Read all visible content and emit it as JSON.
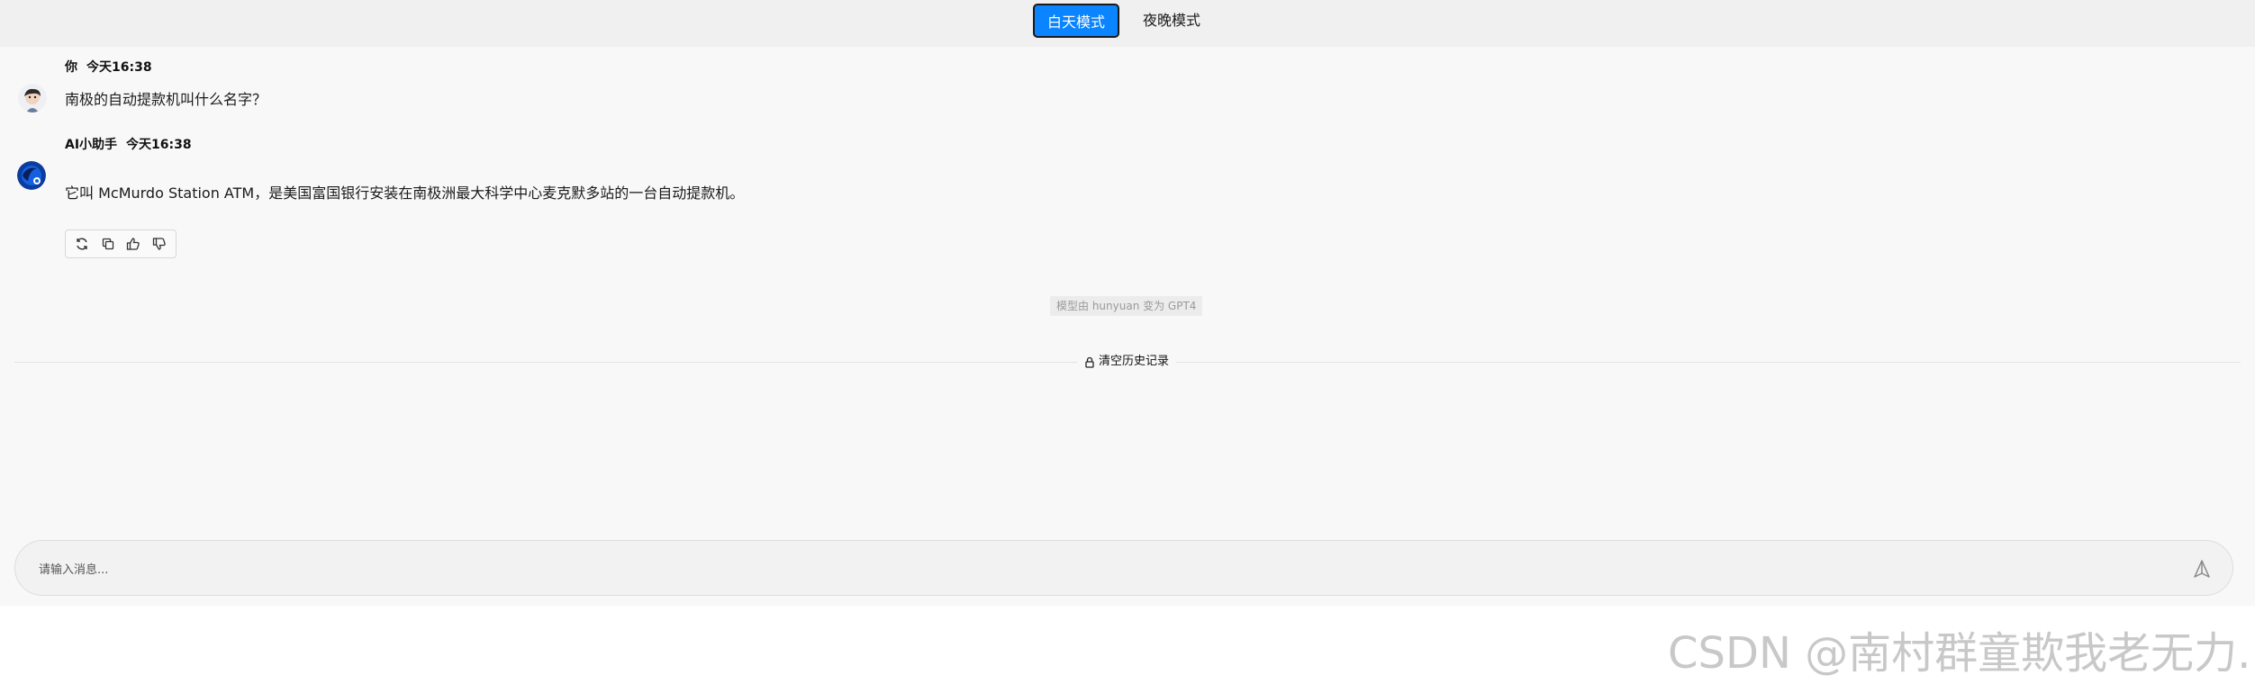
{
  "mode_switch": {
    "day_label": "白天模式",
    "night_label": "夜晚模式",
    "active": "day",
    "accent_color": "#0a84ff"
  },
  "messages": [
    {
      "role": "user",
      "author": "你",
      "time": "今天16:38",
      "text": "南极的自动提款机叫什么名字？",
      "avatar_icon": "user-avatar-icon"
    },
    {
      "role": "assistant",
      "author": "AI小助手",
      "time": "今天16:38",
      "text": "它叫 McMurdo Station ATM，是美国富国银行安装在南极洲最大科学中心麦克默多站的一台自动提款机。",
      "avatar_icon": "ai-avatar-icon"
    }
  ],
  "message_actions": [
    "refresh-icon",
    "copy-icon",
    "thumbs-up-icon",
    "thumbs-down-icon"
  ],
  "model_notice": "模型由 hunyuan 变为 GPT4",
  "clear_history": {
    "label": "清空历史记录",
    "icon": "lock-icon"
  },
  "composer": {
    "placeholder": "请输入消息...",
    "value": "",
    "send_icon": "send-icon"
  },
  "watermark": "CSDN @南村群童欺我老无力."
}
